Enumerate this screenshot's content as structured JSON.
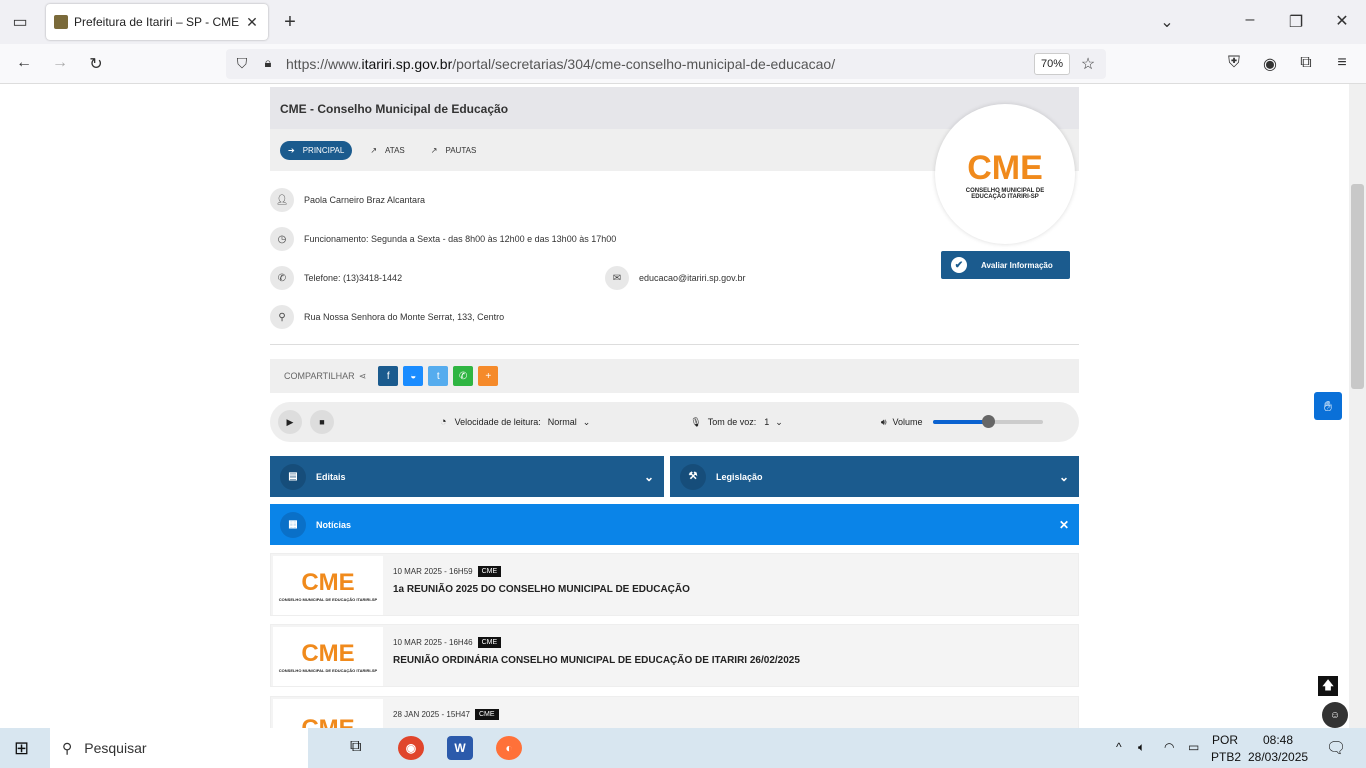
{
  "browser": {
    "tab_title": "Prefeitura de Itariri – SP - CME",
    "url_prefix": "https://www.",
    "url_domain": "itariri.sp.gov.br",
    "url_path": "/portal/secretarias/304/cme-conselho-municipal-de-educacao/",
    "zoom": "70%"
  },
  "page": {
    "title": "CME - Conselho Municipal de Educação",
    "tabs": [
      "PRINCIPAL",
      "ATAS",
      "PAUTAS"
    ],
    "person": "Paola Carneiro Braz Alcantara",
    "hours": "Funcionamento: Segunda a Sexta - das 8h00 às 12h00 e das 13h00 às 17h00",
    "phone": "Telefone: (13)3418-1442",
    "email": "educacao@itariri.sp.gov.br",
    "address": "Rua Nossa Senhora do Monte Serrat, 133, Centro",
    "logo_text": "CME",
    "logo_sub": "CONSELHO MUNICIPAL DE EDUCAÇÃO ITARIRI-SP",
    "avaliar": "Avaliar Informação",
    "share_label": "COMPARTILHAR",
    "player": {
      "speed_label": "Velocidade de leitura:",
      "speed_value": "Normal",
      "tone_label": "Tom de voz:",
      "tone_value": "1",
      "volume_label": "Volume",
      "volume_level": 0.5
    },
    "accordions": [
      "Editais",
      "Legislação",
      "Notícias"
    ],
    "news": [
      {
        "date": "10 MAR 2025 - 16H59",
        "tag": "CME",
        "title": "1a REUNIÃO 2025 DO CONSELHO MUNICIPAL DE EDUCAÇÃO"
      },
      {
        "date": "10 MAR 2025 - 16H46",
        "tag": "CME",
        "title": "REUNIÃO ORDINÁRIA CONSELHO MUNICIPAL DE EDUCAÇÃO DE ITARIRI 26/02/2025"
      },
      {
        "date": "28 JAN 2025 - 15H47",
        "tag": "CME",
        "title": ""
      }
    ]
  },
  "taskbar": {
    "search": "Pesquisar",
    "lang": "POR",
    "layout": "PTB2",
    "time": "08:48",
    "date": "28/03/2025"
  },
  "colors": {
    "primary": "#1b5b8e",
    "news_bar": "#0a84e8",
    "orange": "#f08a1c"
  }
}
